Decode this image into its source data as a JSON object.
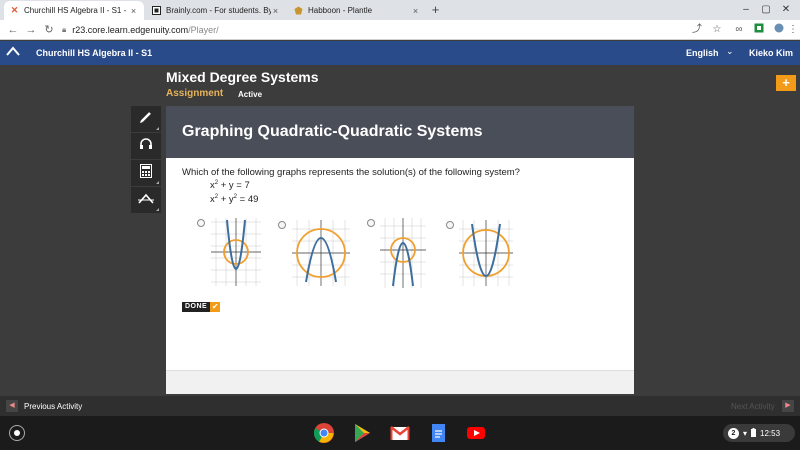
{
  "browser": {
    "tabs": [
      {
        "label": "Churchill HS Algebra II - S1 - Edg",
        "icon": "edgenuity-x-icon",
        "active": true
      },
      {
        "label": "Brainly.com - For students. By st",
        "icon": "brainly-icon",
        "active": false
      },
      {
        "label": "Habboon - Plantle",
        "icon": "habboon-icon",
        "active": false
      }
    ],
    "url_host": "r23.core.learn.edgenuity.com",
    "url_path": "/Player/",
    "close_glyph": "×",
    "new_tab_glyph": "+"
  },
  "header": {
    "course": "Churchill HS Algebra II - S1",
    "language": "English",
    "user": "Kieko Kim"
  },
  "lesson": {
    "title": "Mixed Degree Systems",
    "type": "Assignment",
    "status": "Active"
  },
  "tools": [
    "pencil-icon",
    "headphones-icon",
    "calculator-icon",
    "formula-icon"
  ],
  "activity": {
    "title": "Graphing Quadratic-Quadratic Systems",
    "question": "Which of the following graphs represents the solution(s) of the following system?",
    "eq1": {
      "base": "x",
      "exp": "2",
      "rest": " + y = 7"
    },
    "eq2": {
      "base1": "x",
      "exp1": "2",
      "mid": " + y",
      "exp2": "2",
      "rest": " = 49"
    },
    "options": [
      "option-a",
      "option-b",
      "option-c",
      "option-d"
    ],
    "done_label": "DONE",
    "done_check": "✔"
  },
  "footer": {
    "prev_label": "Previous Activity",
    "next_label": "Next Activity"
  },
  "shelf": {
    "apps": [
      "chrome-icon",
      "play-store-icon",
      "gmail-icon",
      "docs-icon",
      "youtube-icon"
    ],
    "notification_count": "2",
    "time": "12:53"
  },
  "colors": {
    "header_blue": "#2a4b8a",
    "accent_orange": "#f29b18",
    "circle_orange": "#f0a030",
    "parabola_blue": "#3d6e9e"
  }
}
